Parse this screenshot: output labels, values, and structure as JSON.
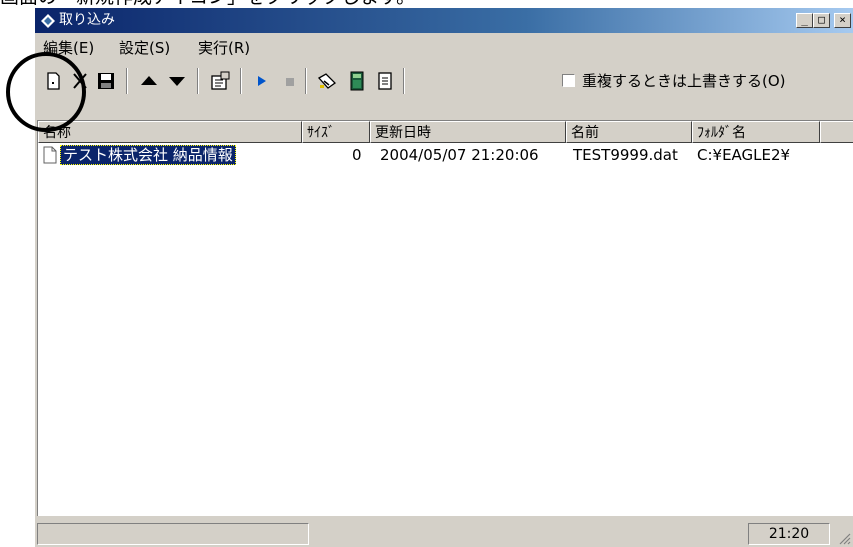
{
  "instruction_text": "画面の「新規作成アイコン」をクリックします。",
  "window": {
    "title": "取り込み",
    "buttons": {
      "minimize": "_",
      "maximize": "□",
      "close": "×"
    }
  },
  "menu": [
    {
      "label": "編集(E)"
    },
    {
      "label": "設定(S)"
    },
    {
      "label": "実行(R)"
    }
  ],
  "toolbar": {
    "overwrite_checkbox_label": "重複するときは上書きする(O)",
    "overwrite_checked": false,
    "icons": [
      "new-icon",
      "delete-icon",
      "save-icon",
      "move-up-icon",
      "move-down-icon",
      "properties-icon",
      "run-icon",
      "stop-icon",
      "import-icon",
      "calculator-icon",
      "notepad-icon"
    ]
  },
  "list": {
    "columns": [
      "名称",
      "ｻｲｽﾞ",
      "更新日時",
      "名前",
      "ﾌｫﾙﾀﾞ名"
    ],
    "rows": [
      {
        "name": "テスト株式会社 納品情報",
        "size": "0",
        "modified": "2004/05/07 21:20:06",
        "filename": "TEST9999.dat",
        "folder": "C:¥EAGLE2¥"
      }
    ]
  },
  "status": {
    "clock": "21:20"
  },
  "colors": {
    "titlebar": "#0a246a",
    "selection": "#0a246a",
    "face": "#d4d0c8"
  }
}
